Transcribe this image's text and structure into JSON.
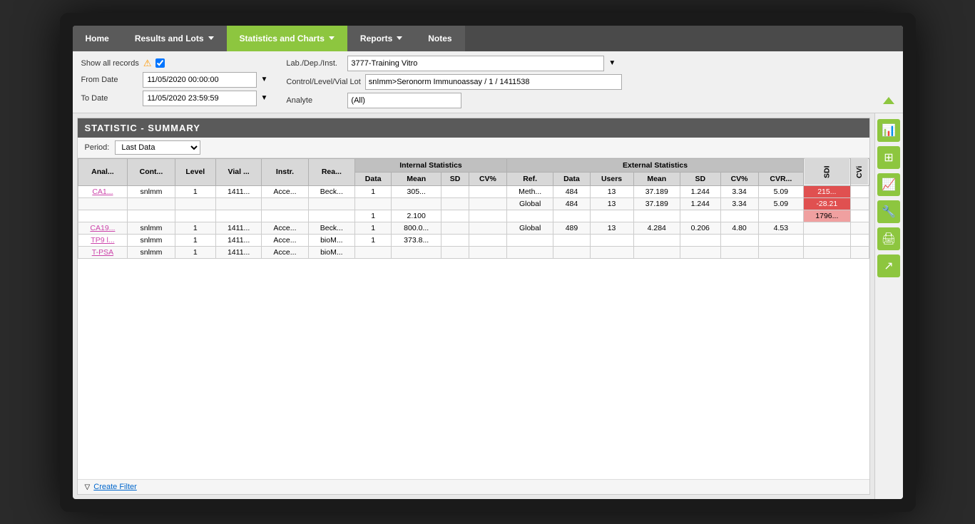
{
  "nav": {
    "home_label": "Home",
    "results_lots_label": "Results and Lots",
    "stats_charts_label": "Statistics and Charts",
    "reports_label": "Reports",
    "notes_label": "Notes"
  },
  "filter": {
    "show_all_records_label": "Show all records",
    "from_date_label": "From Date",
    "to_date_label": "To Date",
    "lab_dep_inst_label": "Lab./Dep./Inst.",
    "control_level_vial_lot_label": "Control/Level/Vial Lot",
    "analyte_label": "Analyte",
    "from_date_value": "11/05/2020 00:00:00",
    "to_date_value": "11/05/2020 23:59:59",
    "lab_value": "3777-Training Vitro",
    "control_value": "snImm>Seronorm Immunoassay / 1 / 1411538",
    "analyte_value": "(All)"
  },
  "section": {
    "title": "STATISTIC - SUMMARY",
    "period_label": "Period:",
    "period_value": "Last Data"
  },
  "table": {
    "col_headers": [
      "Anal...",
      "Cont...",
      "Level",
      "Vial ...",
      "Instr.",
      "Rea...",
      "Data",
      "Mean",
      "SD",
      "CV%",
      "Ref.",
      "Data",
      "Users",
      "Mean",
      "SD",
      "CV%",
      "CVR...",
      "SDI",
      "CVi"
    ],
    "internal_stats_header": "Internal Statistics",
    "external_stats_header": "External Statistics",
    "rows": [
      {
        "analyte": "CA1...",
        "control": "snlmm",
        "level": "1",
        "vial": "1411...",
        "instr": "Acce...",
        "rea": "Beck...",
        "data": "1",
        "mean": "305...",
        "sd": "",
        "cv": "",
        "ref": "Meth...",
        "ext_data": "484",
        "users": "13",
        "ext_mean": "37.189",
        "ext_sd": "1.244",
        "ext_cv": "3.34",
        "cvr": "5.09",
        "sdi": "215...",
        "cvi": "",
        "sdi_class": "cell-red",
        "row_class": ""
      },
      {
        "analyte": "",
        "control": "",
        "level": "",
        "vial": "",
        "instr": "",
        "rea": "",
        "data": "",
        "mean": "",
        "sd": "",
        "cv": "",
        "ref": "Global",
        "ext_data": "484",
        "users": "13",
        "ext_mean": "37.189",
        "ext_sd": "1.244",
        "ext_cv": "3.34",
        "cvr": "5.09",
        "sdi": "-28.21",
        "cvi": "",
        "sdi_class": "cell-red",
        "row_class": ""
      },
      {
        "analyte": "",
        "control": "",
        "level": "",
        "vial": "",
        "instr": "",
        "rea": "",
        "data": "1",
        "mean": "2.100",
        "sd": "",
        "cv": "",
        "ref": "",
        "ext_data": "",
        "users": "",
        "ext_mean": "",
        "ext_sd": "",
        "ext_cv": "",
        "cvr": "",
        "sdi": "1796...",
        "cvi": "",
        "sdi_class": "cell-pink",
        "row_class": ""
      },
      {
        "analyte": "CA19...",
        "control": "snlmm",
        "level": "1",
        "vial": "1411...",
        "instr": "Acce...",
        "rea": "Beck...",
        "data": "1",
        "mean": "800.0...",
        "sd": "",
        "cv": "",
        "ref": "Global",
        "ext_data": "489",
        "users": "13",
        "ext_mean": "4.284",
        "ext_sd": "0.206",
        "ext_cv": "4.80",
        "cvr": "4.53",
        "sdi": "",
        "cvi": "",
        "sdi_class": "",
        "row_class": ""
      },
      {
        "analyte": "TP9 l...",
        "control": "snlmm",
        "level": "1",
        "vial": "1411...",
        "instr": "Acce...",
        "rea": "bioM...",
        "data": "1",
        "mean": "373.8...",
        "sd": "",
        "cv": "",
        "ref": "",
        "ext_data": "",
        "users": "",
        "ext_mean": "",
        "ext_sd": "",
        "ext_cv": "",
        "cvr": "",
        "sdi": "",
        "cvi": "",
        "sdi_class": "",
        "row_class": ""
      },
      {
        "analyte": "T-PSA",
        "control": "snlmm",
        "level": "1",
        "vial": "1411...",
        "instr": "Acce...",
        "rea": "bioM...",
        "data": "",
        "mean": "",
        "sd": "",
        "cv": "",
        "ref": "",
        "ext_data": "",
        "users": "",
        "ext_mean": "",
        "ext_sd": "",
        "ext_cv": "",
        "cvr": "",
        "sdi": "",
        "cvi": "",
        "sdi_class": "",
        "row_class": ""
      }
    ]
  },
  "sidebar_icons": [
    {
      "name": "chart-bar-icon",
      "symbol": "📊"
    },
    {
      "name": "grid-icon",
      "symbol": "⊞"
    },
    {
      "name": "chart-line-icon",
      "symbol": "📈"
    },
    {
      "name": "tools-icon",
      "symbol": "🔧"
    },
    {
      "name": "print-icon",
      "symbol": "🖨"
    },
    {
      "name": "export-icon",
      "symbol": "↗"
    }
  ],
  "footer": {
    "create_filter_label": "Create Filter"
  }
}
